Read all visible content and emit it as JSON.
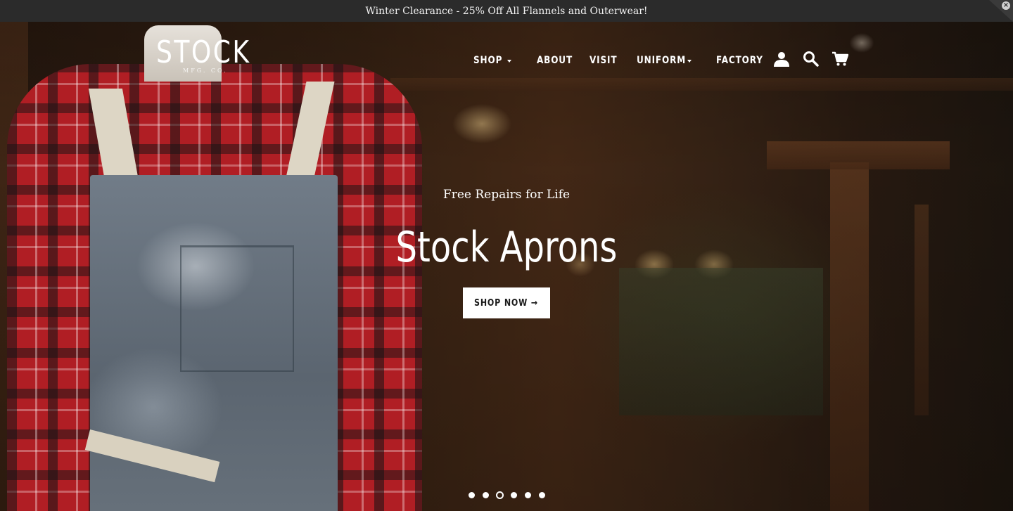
{
  "announcement": {
    "text": "Winter Clearance - 25% Off All Flannels and Outerwear!",
    "close_icon": "close-circle-icon"
  },
  "logo": {
    "word": "STOCK",
    "sub": "MFG. CO."
  },
  "nav": {
    "items": [
      {
        "label": "SHOP",
        "has_dropdown": true
      },
      {
        "label": "ABOUT",
        "has_dropdown": false
      },
      {
        "label": "VISIT",
        "has_dropdown": false
      },
      {
        "label": "UNIFORM",
        "has_dropdown": true
      },
      {
        "label": "FACTORY",
        "has_dropdown": false
      }
    ],
    "icons": [
      "account-icon",
      "search-icon",
      "cart-icon"
    ]
  },
  "hero": {
    "subtitle": "Free Repairs for Life",
    "title": "Stock Aprons",
    "button_label": "SHOP NOW →",
    "slides_total": 6,
    "active_slide": 3
  },
  "colors": {
    "announcement_bg": "#2b2b2b",
    "text": "#ffffff",
    "button_bg": "#ffffff",
    "button_text": "#1a1a1a"
  }
}
